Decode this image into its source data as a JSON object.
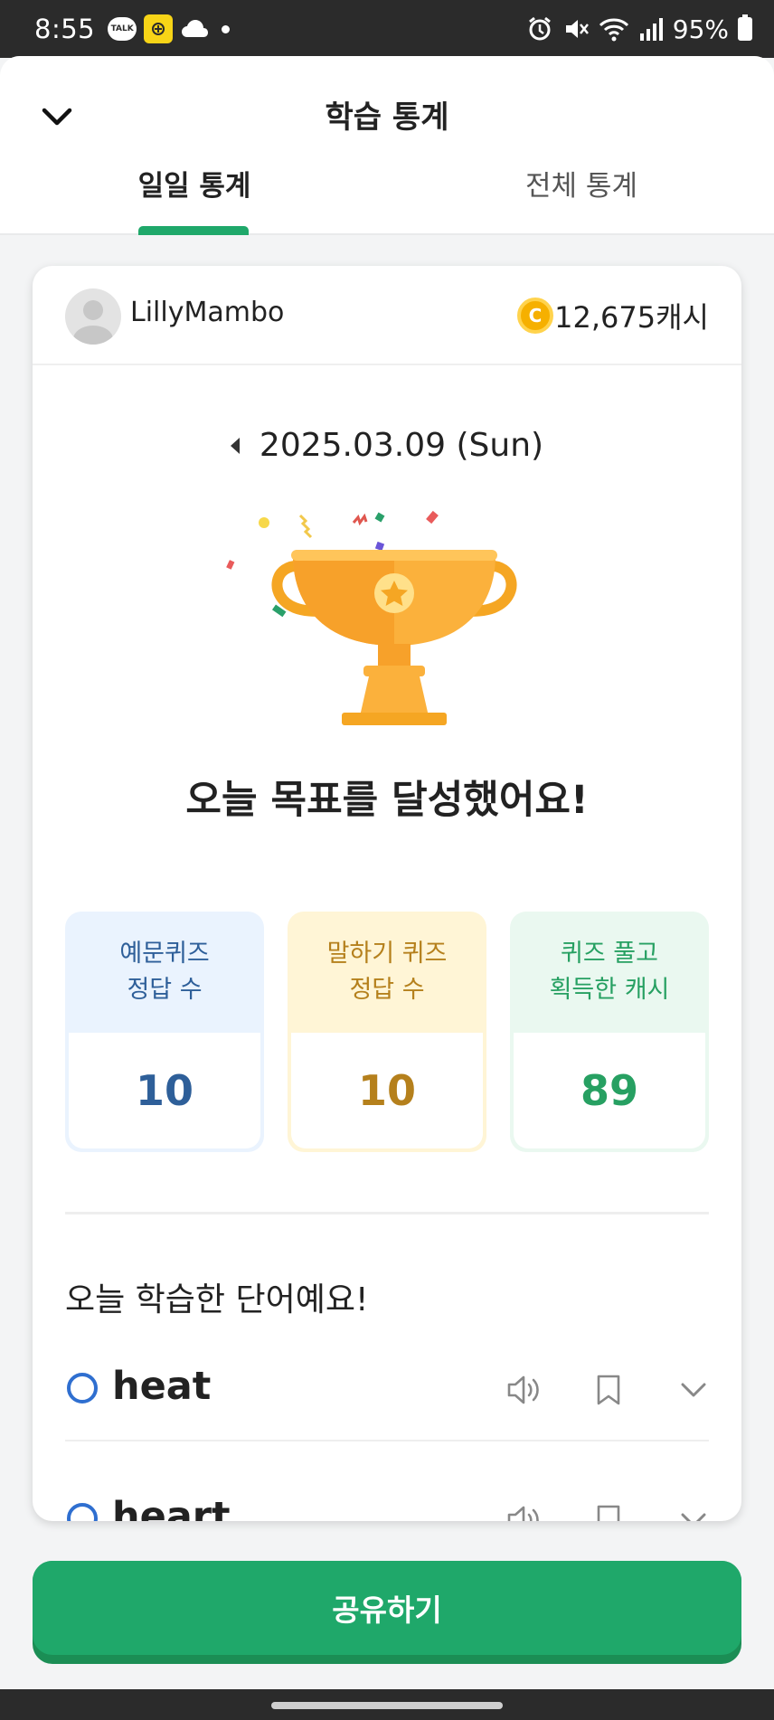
{
  "status_bar": {
    "time": "8:55",
    "talk_icon_text": "TALK",
    "battery_percent": "95%",
    "icons": [
      "talk-icon",
      "app-yellow-icon",
      "cloud-icon",
      "dot-icon",
      "alarm-icon",
      "mute-icon",
      "wifi-icon",
      "signal-icon",
      "battery-icon"
    ]
  },
  "header": {
    "title": "학습 통계",
    "back_icon": "chevron-down-icon",
    "tabs": [
      {
        "label": "일일 통계",
        "active": true
      },
      {
        "label": "전체 통계",
        "active": false
      }
    ]
  },
  "profile": {
    "username": "LillyMambo",
    "coin_symbol": "C",
    "cash": "12,675캐시"
  },
  "date": {
    "text": "2025.03.09 (Sun)",
    "prev_icon": "caret-left-icon"
  },
  "goal": {
    "image": "trophy-icon",
    "message": "오늘 목표를 달성했어요!"
  },
  "stats": [
    {
      "label": "예문퀴즈\n정답 수",
      "value": "10",
      "color": "#2e5f99"
    },
    {
      "label": "말하기 퀴즈\n정답 수",
      "value": "10",
      "color": "#b5801c"
    },
    {
      "label": "퀴즈 풀고\n획득한 캐시",
      "value": "89",
      "color": "#27a062"
    }
  ],
  "words_section": {
    "title": "오늘 학습한 단어예요!",
    "words": [
      {
        "word": "heat"
      },
      {
        "word": "heart"
      }
    ],
    "row_icons": [
      "speaker-icon",
      "bookmark-icon",
      "chevron-down-icon"
    ]
  },
  "share_button": {
    "label": "공유하기",
    "color": "#1fa86a"
  }
}
